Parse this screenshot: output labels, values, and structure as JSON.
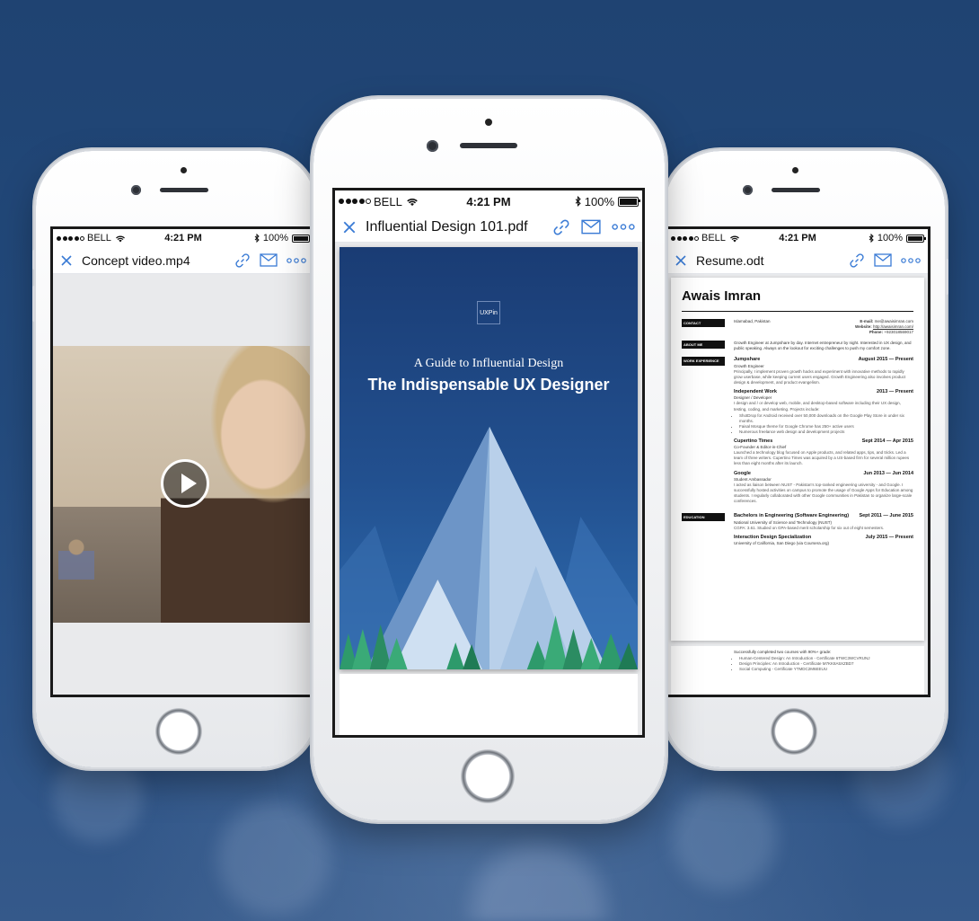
{
  "status_bar": {
    "carrier": "BELL",
    "time": "4:21 PM",
    "battery": "100%"
  },
  "colors": {
    "accent": "#3a7bd5",
    "background": "#234a7c",
    "pdf_cover": "#1a3c74"
  },
  "icons": {
    "close": "close-icon",
    "link": "link-icon",
    "mail": "mail-icon",
    "more": "more-icon",
    "play": "play-icon",
    "wifi": "wifi-icon",
    "bluetooth": "bluetooth-icon"
  },
  "left_phone": {
    "title": "Concept video.mp4"
  },
  "center_phone": {
    "title": "Influential Design 101.pdf",
    "pdf": {
      "logo": "UXPin",
      "subtitle": "A Guide to Influential Design",
      "title": "The Indispensable UX Designer"
    }
  },
  "right_phone": {
    "title": "Resume.odt",
    "resume": {
      "name": "Awais Imran",
      "contact": {
        "tag": "CONTACT",
        "location": "Islamabad, Pakistan",
        "email_label": "E-mail:",
        "email": "me@awaisimran.com",
        "website_label": "Website:",
        "website": "http://awaisimran.com/",
        "phone_label": "Phone:",
        "phone": "+923018569017"
      },
      "about": {
        "tag": "ABOUT ME",
        "text": "Growth Engineer at Jumpshare by day. Internet entrepreneur by night. Interested in UX design, and public speaking. Always on the lookout for exciting challenges to push my comfort zone."
      },
      "work_tag": "WORK EXPERIENCE",
      "work": [
        {
          "company": "Jumpshare",
          "dates": "August 2015 — Present",
          "role": "Growth Engineer",
          "desc": "Principally, I implement proven growth hacks and experiment with innovative methods to rapidly grow userbase, while keeping current users engaged. Growth Engineering also involves product design & development, and product evangelism."
        },
        {
          "company": "Independent Work",
          "dates": "2013 — Present",
          "role": "Designer / Developer",
          "desc": "I design and / or develop web, mobile, and desktop-based software including their UX design, testing, coding, and marketing. Projects include:",
          "bullets": [
            "ShotDrop for Android received over 50,000 downloads on the Google Play Store in under six months.",
            "Faisal Mosque theme for Google Chrome has 250+ active users",
            "Numerous freelance web design and development projects"
          ]
        },
        {
          "company": "Cupertino Times",
          "dates": "Sept 2014 — Apr 2015",
          "role": "Co-Founder & Editor-in-Chief",
          "desc": "Launched a technology blog focused on Apple products, and related apps, tips, and tricks. Led a team of three writers. Cupertino Times was acquired by a US-based firm for several million rupees less than eight months after its launch."
        },
        {
          "company": "Google",
          "dates": "Jun 2013 — Jun 2014",
          "role": "Student Ambassador",
          "desc": "I acted as liaison between NUST - Pakistan's top-ranked engineering university - and Google. I successfully hosted activities on campus to promote the usage of Google Apps for Education among students. I regularly collaborated with other Google communities in Pakistan to organize large-scale conferences."
        }
      ],
      "education_tag": "EDUCATION",
      "education": [
        {
          "degree": "Bachelors in Engineering (Software Engineering)",
          "dates": "Sept 2011 — June 2015",
          "school": "National University of Science and Technology (NUST)",
          "desc": "CGPA: 3.61. Studied on GPA-based merit scholarship for six out of eight semesters."
        },
        {
          "degree": "Interaction Design Specialization",
          "dates": "July 2015 — Present",
          "school": "University of California, San Diego (via Coursera.org)"
        }
      ],
      "page2": {
        "intro": "Successfully completed two courses with 90%+ grade:",
        "items": [
          "Human-Centered Design: An Introduction - Certificate 6TWC3WCVRUNJ",
          "Design Principles: An Introduction - Certificate M7KK8A5XZBD7",
          "Social Computing - Certificate YTMDC2M6EEUU"
        ]
      }
    }
  }
}
